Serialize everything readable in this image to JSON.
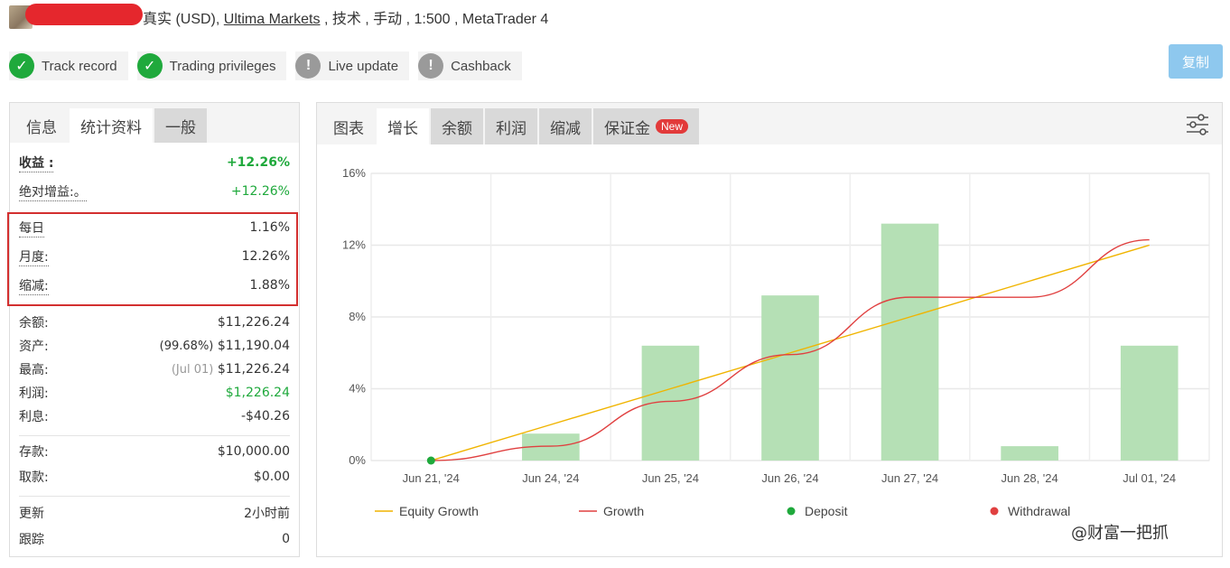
{
  "header": {
    "type_text": "真实 (USD),",
    "broker": "Ultima Markets",
    "rest": ", 技术 , 手动 , 1:500 , MetaTrader 4"
  },
  "badges": [
    {
      "label": "Track record",
      "status": "ok"
    },
    {
      "label": "Trading privileges",
      "status": "ok"
    },
    {
      "label": "Live update",
      "status": "warn"
    },
    {
      "label": "Cashback",
      "status": "warn"
    }
  ],
  "copy_button": "复制",
  "left_tabs": [
    "信息",
    "统计资料",
    "一般"
  ],
  "stats": {
    "gain_label": "收益 :",
    "gain_value": "+12.26%",
    "abs_label": "绝对增益:。",
    "abs_value": "+12.26%",
    "daily_label": "每日",
    "daily_value": "1.16%",
    "monthly_label": "月度:",
    "monthly_value": "12.26%",
    "drawdown_label": "缩减:",
    "drawdown_value": "1.88%",
    "balance_label": "余额:",
    "balance_value": "$11,226.24",
    "equity_label": "资产:",
    "equity_pct": "(99.68%)",
    "equity_value": "$11,190.04",
    "highest_label": "最高:",
    "highest_date": "(Jul 01)",
    "highest_value": "$11,226.24",
    "profit_label": "利润:",
    "profit_value": "$1,226.24",
    "interest_label": "利息:",
    "interest_value": "-$40.26",
    "deposits_label": "存款:",
    "deposits_value": "$10,000.00",
    "withdrawals_label": "取款:",
    "withdrawals_value": "$0.00",
    "updated_label": "更新",
    "updated_value": "2小时前",
    "tracking_label": "跟踪",
    "tracking_value": "0"
  },
  "right_tabs": [
    "图表",
    "增长",
    "余额",
    "利润",
    "缩减",
    "保证金"
  ],
  "new_badge": "New",
  "chart_data": {
    "type": "bar",
    "categories": [
      "Jun 21, '24",
      "Jun 24, '24",
      "Jun 25, '24",
      "Jun 26, '24",
      "Jun 27, '24",
      "Jun 28, '24",
      "Jul 01, '24"
    ],
    "y_ticks": [
      "0%",
      "4%",
      "8%",
      "12%",
      "16%"
    ],
    "ylim": [
      0,
      16
    ],
    "series": [
      {
        "name": "Equity Growth",
        "type": "line",
        "color": "#f0b400",
        "values": [
          0.0,
          2.0,
          4.0,
          6.0,
          8.0,
          10.0,
          12.0
        ]
      },
      {
        "name": "Growth",
        "type": "line",
        "color": "#e04040",
        "values": [
          0.0,
          0.8,
          3.3,
          5.9,
          9.1,
          9.1,
          12.3
        ]
      },
      {
        "name": "Deposit",
        "type": "marker",
        "color": "#1fa93c"
      },
      {
        "name": "Withdrawal",
        "type": "marker",
        "color": "#e04040"
      }
    ],
    "bars": [
      null,
      1.5,
      6.4,
      9.2,
      13.2,
      0.8,
      6.4
    ],
    "bar_color": "#b5e0b5",
    "grid": true,
    "legend": "bottom"
  },
  "watermark": "@财富一把抓"
}
